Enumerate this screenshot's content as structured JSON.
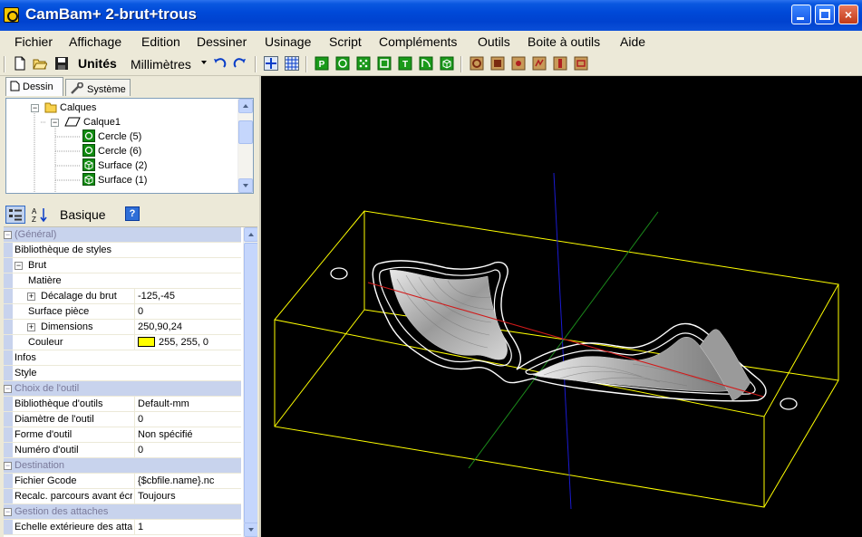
{
  "window": {
    "title": "CamBam+   2-brut+trous",
    "controls": {
      "minimize": "minimize",
      "maximize": "maximize",
      "close": "×"
    }
  },
  "menu": [
    "Fichier",
    "Affichage",
    "Edition",
    "Dessiner",
    "Usinage",
    "Script",
    "Compléments",
    "Outils",
    "Boite à outils",
    "Aide"
  ],
  "toolbar": {
    "units_label": "Unités",
    "units_value": "Millimètres",
    "icons": [
      "new-file-icon",
      "open-folder-icon",
      "save-disk-icon",
      "undo-icon",
      "redo-icon",
      "axis-icon",
      "grid-icon",
      "polyline-icon",
      "circle-icon",
      "points-icon",
      "rectangle-icon",
      "text-icon",
      "arc-icon",
      "surface-icon",
      "profile-op-icon",
      "pocket-op-icon",
      "drill-op-icon",
      "engrave-op-icon",
      "lathe-op-icon",
      "3d-op-icon"
    ]
  },
  "left_panel": {
    "tabs": [
      {
        "label": "Dessin",
        "active": true
      },
      {
        "label": "Système",
        "active": false
      }
    ],
    "tree": [
      {
        "label": "Calques",
        "depth": 0,
        "type": "folder"
      },
      {
        "label": "Calque1",
        "depth": 1,
        "type": "layer"
      },
      {
        "label": "Cercle (5)",
        "depth": 2,
        "type": "circle"
      },
      {
        "label": "Cercle (6)",
        "depth": 2,
        "type": "circle"
      },
      {
        "label": "Surface (2)",
        "depth": 2,
        "type": "surface"
      },
      {
        "label": "Surface (1)",
        "depth": 2,
        "type": "surface"
      }
    ],
    "props_toolbar": {
      "mode_label": "Basique",
      "help": "?"
    },
    "properties": [
      {
        "kind": "category",
        "name": "(Général)"
      },
      {
        "kind": "prop",
        "name": "Bibliothèque de styles",
        "value": ""
      },
      {
        "kind": "prop",
        "name": "Brut",
        "value": "",
        "expander": "minus",
        "indent": 0
      },
      {
        "kind": "prop",
        "name": "Matière",
        "value": "",
        "indent": 1
      },
      {
        "kind": "prop",
        "name": "Décalage du brut",
        "value": "-125,-45",
        "expander": "plus",
        "indent": 1
      },
      {
        "kind": "prop",
        "name": "Surface pièce",
        "value": "0",
        "indent": 1
      },
      {
        "kind": "prop",
        "name": "Dimensions",
        "value": "250,90,24",
        "expander": "plus",
        "indent": 1
      },
      {
        "kind": "prop",
        "name": "Couleur",
        "value": "255, 255, 0",
        "swatch": "#ffff00",
        "indent": 1
      },
      {
        "kind": "prop",
        "name": "Infos",
        "value": ""
      },
      {
        "kind": "prop",
        "name": "Style",
        "value": ""
      },
      {
        "kind": "category",
        "name": "Choix de l'outil"
      },
      {
        "kind": "prop",
        "name": "Bibliothèque d'outils",
        "value": "Default-mm"
      },
      {
        "kind": "prop",
        "name": "Diamètre de l'outil",
        "value": "0"
      },
      {
        "kind": "prop",
        "name": "Forme d'outil",
        "value": "Non spécifié"
      },
      {
        "kind": "prop",
        "name": "Numéro d'outil",
        "value": "0"
      },
      {
        "kind": "category",
        "name": "Destination"
      },
      {
        "kind": "prop",
        "name": "Fichier Gcode",
        "value": "{$cbfile.name}.nc"
      },
      {
        "kind": "prop",
        "name": "Recalc. parcours avant écr",
        "value": "Toujours"
      },
      {
        "kind": "category",
        "name": "Gestion des attaches"
      },
      {
        "kind": "prop",
        "name": "Echelle extérieure des attac",
        "value": "1"
      }
    ]
  },
  "viewport": {
    "background": "#000000",
    "stock_color": "#ffff00",
    "axis_colors": {
      "x": "#c00000",
      "y": "#008000",
      "z": "#0000c0"
    }
  }
}
